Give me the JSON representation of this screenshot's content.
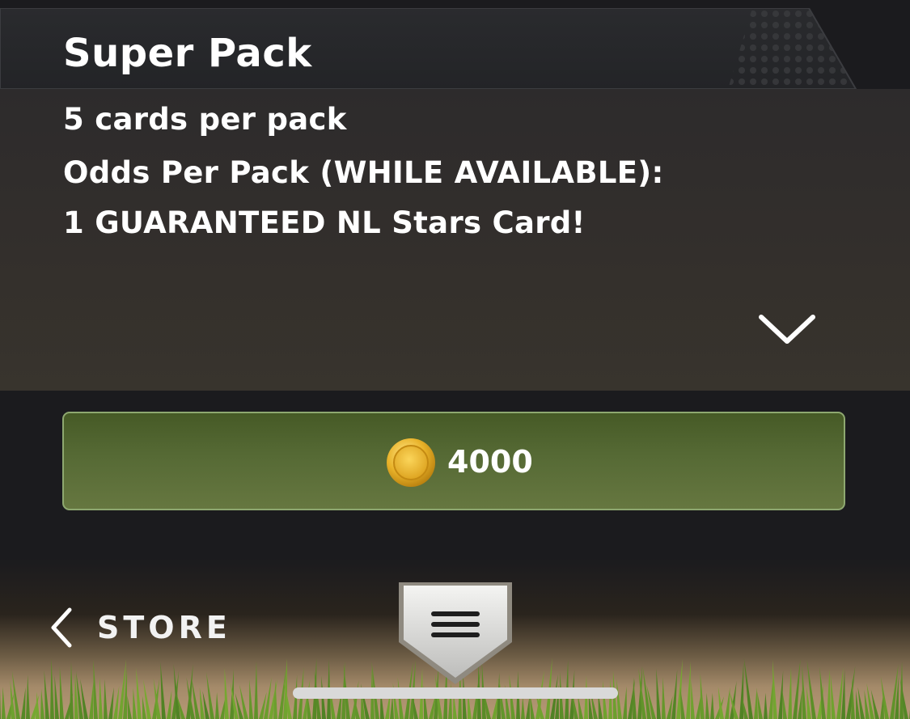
{
  "pack": {
    "title": "Super Pack",
    "cards_per_pack": "5 cards per pack",
    "odds_heading": "Odds Per Pack (WHILE AVAILABLE):",
    "odds_detail": "1 GUARANTEED NL Stars Card!"
  },
  "purchase": {
    "currency_icon": "coin-icon",
    "price": "4000"
  },
  "navigation": {
    "back_label": "STORE",
    "back_icon": "chevron-left-icon",
    "menu_icon": "hamburger-menu-icon",
    "expand_icon": "chevron-down-icon"
  },
  "colors": {
    "buy_button": "#566a35",
    "buy_border": "#8ea870",
    "coin": "#e6b422",
    "grass": "#6b8a2a"
  }
}
